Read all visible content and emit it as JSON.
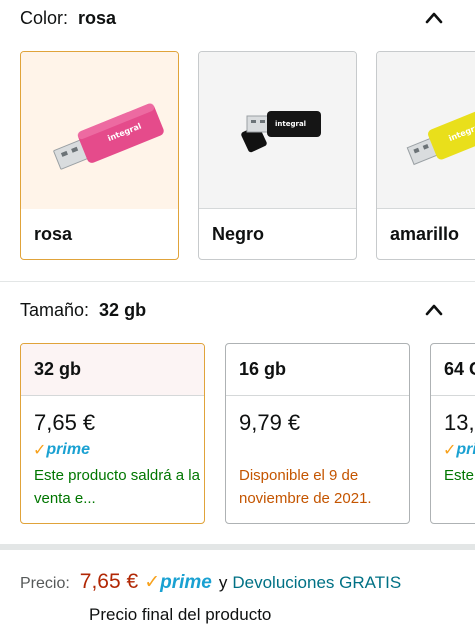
{
  "color": {
    "label": "Color:",
    "selected": "rosa",
    "options": [
      {
        "name": "rosa"
      },
      {
        "name": "Negro"
      },
      {
        "name": "amarillo"
      }
    ],
    "product_brand": "integral"
  },
  "size": {
    "label": "Tamaño:",
    "selected": "32 gb",
    "options": [
      {
        "size": "32 gb",
        "price": "7,65 €",
        "prime": "prime",
        "status": "Este producto saldrá a la venta e..."
      },
      {
        "size": "16 gb",
        "price": "9,79 €",
        "status": "Disponible el 9 de noviembre de 2021."
      },
      {
        "size": "64 G",
        "price": "13,",
        "prime": "pri",
        "status": "Este saldr"
      }
    ]
  },
  "purchase": {
    "price_label": "Precio:",
    "price": "7,65 €",
    "prime": "prime",
    "connector": "y",
    "returns_link": "Devoluciones GRATIS",
    "final_note": "Precio final del producto"
  },
  "colors": {
    "accent_border": "#e0a33a",
    "price_red": "#b12704",
    "link_teal": "#007185",
    "green": "#007600",
    "orange": "#c45500",
    "prime_blue": "#1aa1d2"
  },
  "icons": {
    "collapse": "chevron-up-icon",
    "prime_check": "checkmark-icon"
  }
}
